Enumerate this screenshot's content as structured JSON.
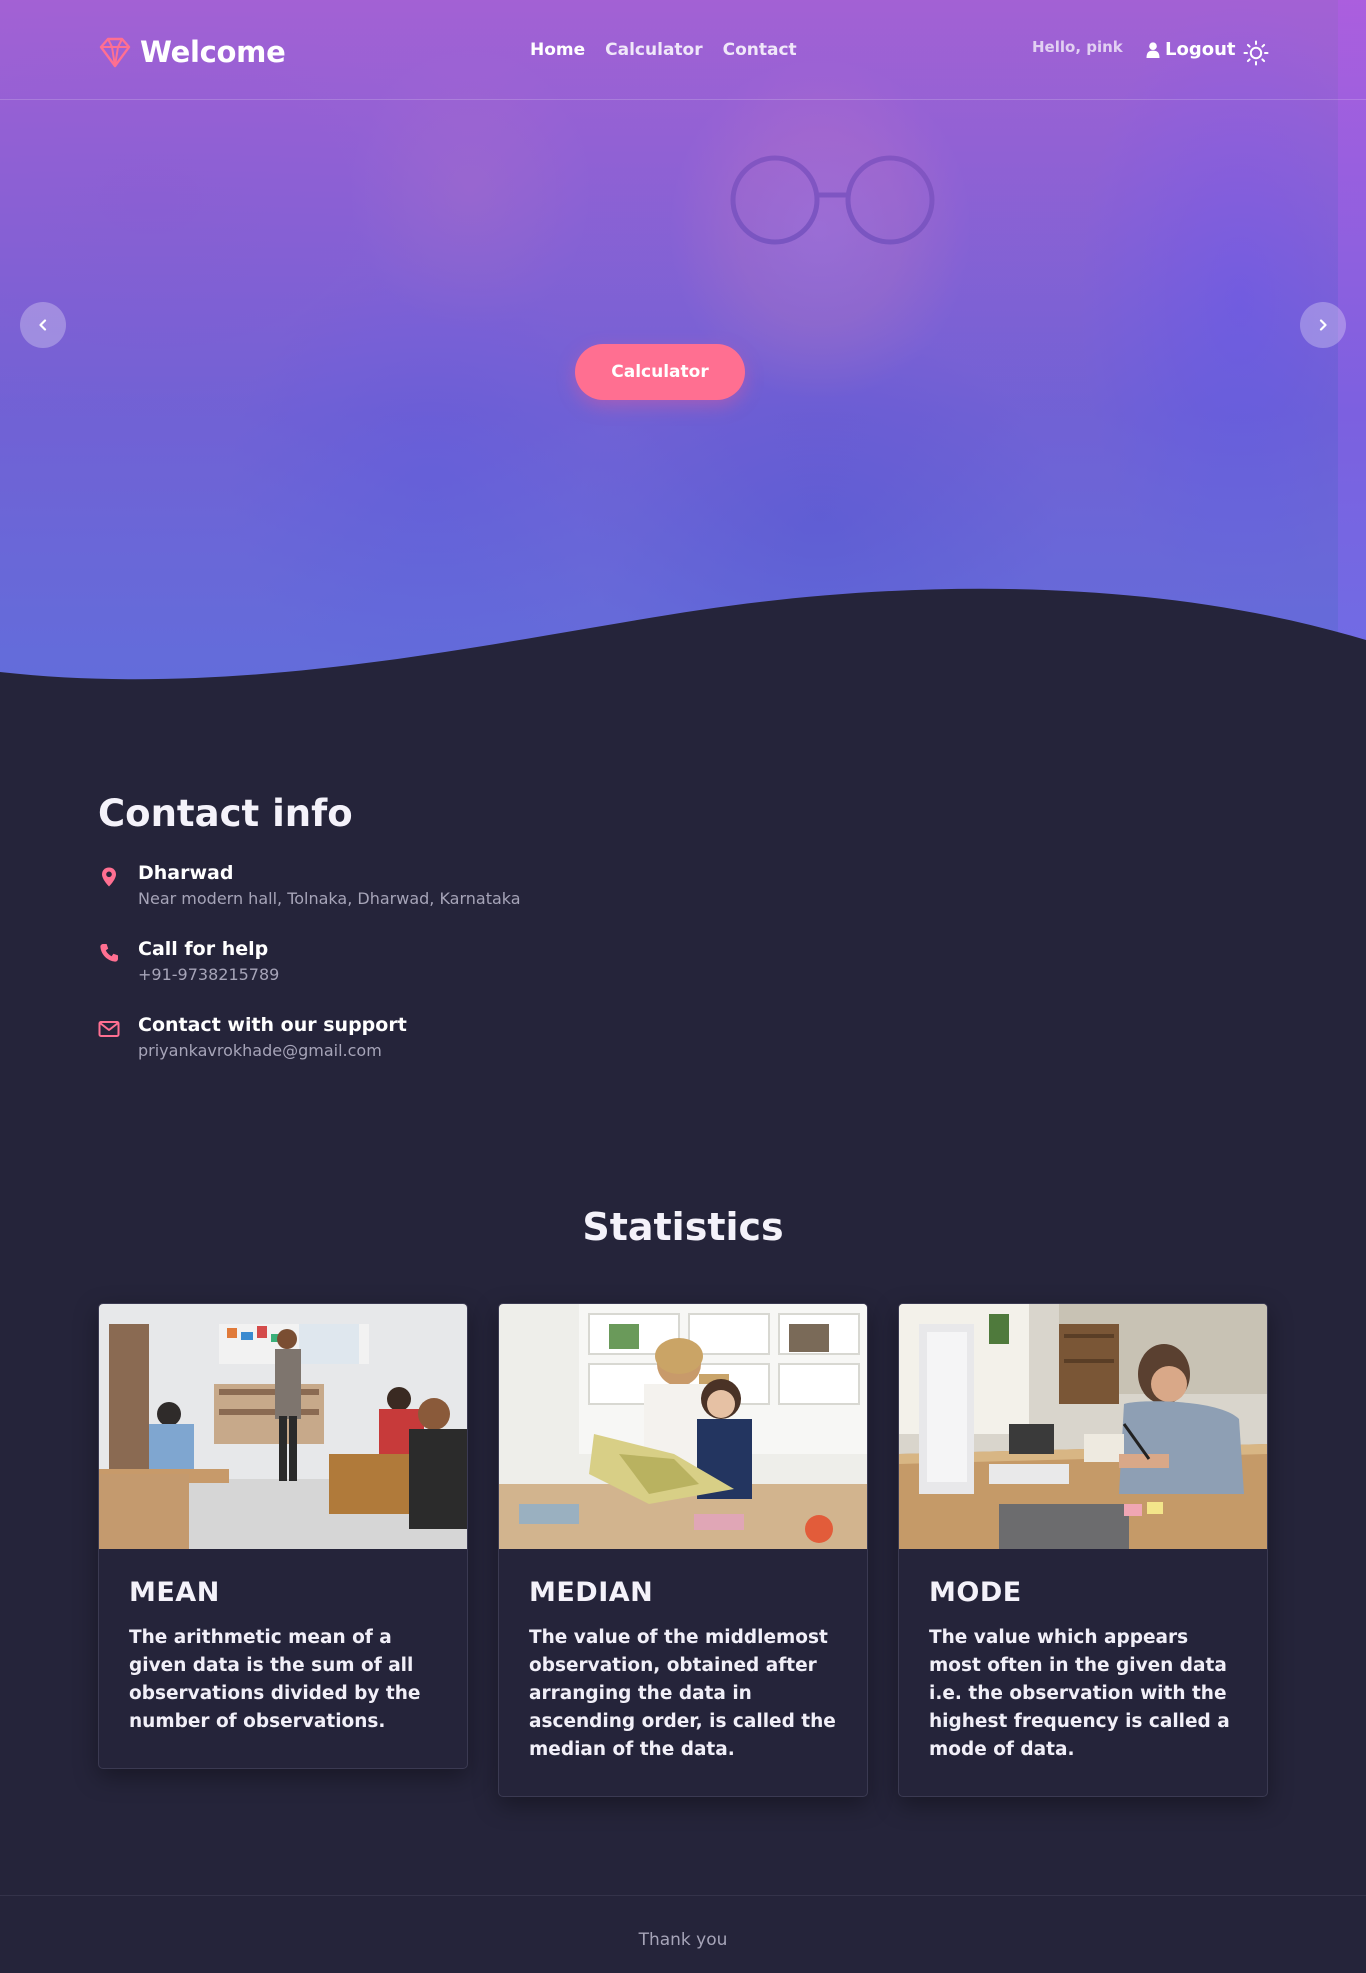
{
  "navbar": {
    "brand": "Welcome",
    "links": [
      {
        "label": "Home"
      },
      {
        "label": "Calculator"
      },
      {
        "label": "Contact"
      }
    ],
    "greeting": "Hello, pink",
    "logout_label": "Logout",
    "brand_icon": "diamond-icon",
    "user_icon": "user-icon",
    "theme_icon": "sun-icon"
  },
  "hero": {
    "cta_label": "Calculator",
    "prev_icon": "chevron-left-icon",
    "next_icon": "chevron-right-icon"
  },
  "contact": {
    "title": "Contact info",
    "items": [
      {
        "icon": "location-pin-icon",
        "heading": "Dharwad",
        "detail": "Near modern hall, Tolnaka, Dharwad, Karnataka"
      },
      {
        "icon": "phone-icon",
        "heading": "Call for help",
        "detail": "+91-9738215789"
      },
      {
        "icon": "envelope-icon",
        "heading": "Contact with our support",
        "detail": "priyankavrokhade@gmail.com"
      }
    ]
  },
  "statistics": {
    "title": "Statistics",
    "cards": [
      {
        "title": "MEAN",
        "text": "The arithmetic mean of a given data is the sum of all observations divided by the number of observations."
      },
      {
        "title": "MEDIAN",
        "text": "The value of the middlemost observation, obtained after arranging the data in ascending order, is called the median of the data."
      },
      {
        "title": "MODE",
        "text": "The value which appears most often in the given data i.e. the observation with the highest frequency is called a mode of data."
      }
    ]
  },
  "footer": {
    "text": "Thank you"
  },
  "colors": {
    "accent": "#ff6f91",
    "background": "#25243a",
    "hero_overlay": "#8f62e0"
  }
}
